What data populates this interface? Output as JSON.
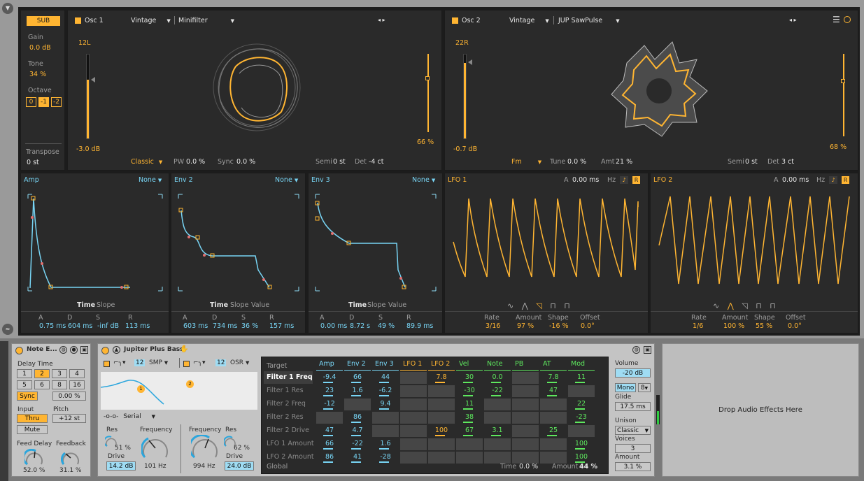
{
  "sub": {
    "label": "SUB",
    "gain_label": "Gain",
    "gain": "0.0 dB",
    "tone_label": "Tone",
    "tone": "34 %",
    "octave_label": "Octave",
    "octaves": [
      "0",
      "-1",
      "-2"
    ],
    "transpose_label": "Transpose",
    "transpose": "0 st"
  },
  "osc1": {
    "title": "Osc 1",
    "type": "Vintage",
    "filter": "Minifilter",
    "level": "12L",
    "db": "-3.0 dB",
    "right_pct": "66 %",
    "mode": "Classic",
    "pw_label": "PW",
    "pw": "0.0 %",
    "sync_label": "Sync",
    "sync": "0.0 %",
    "semi_label": "Semi",
    "semi": "0 st",
    "det_label": "Det",
    "det": "-4 ct"
  },
  "osc2": {
    "title": "Osc 2",
    "type": "Vintage",
    "wave": "JUP SawPulse",
    "level": "22R",
    "db": "-0.7 dB",
    "right_pct": "68 %",
    "mode": "Fm",
    "tune_label": "Tune",
    "tune": "0.0 %",
    "amt_label": "Amt",
    "amt": "21 %",
    "semi_label": "Semi",
    "semi": "0 st",
    "det_label": "Det",
    "det": "3 ct"
  },
  "env": [
    {
      "title": "Amp",
      "mode": "None",
      "tabs": [
        "Time",
        "Slope"
      ],
      "a": "0.75 ms",
      "d": "604 ms",
      "s": "-inf dB",
      "r": "113 ms"
    },
    {
      "title": "Env 2",
      "mode": "None",
      "tabs": [
        "Time",
        "Slope",
        "Value"
      ],
      "a": "603 ms",
      "d": "734 ms",
      "s": "36 %",
      "r": "157 ms"
    },
    {
      "title": "Env 3",
      "mode": "None",
      "tabs": [
        "Time",
        "Slope",
        "Value"
      ],
      "a": "0.00 ms",
      "d": "8.72 s",
      "s": "49 %",
      "r": "89.9 ms"
    }
  ],
  "env_labels": {
    "a": "A",
    "d": "D",
    "s": "S",
    "r": "R"
  },
  "lfo": [
    {
      "title": "LFO 1",
      "a": "A",
      "a_val": "0.00 ms",
      "hz": "Hz",
      "r": "R",
      "rate": "3/16",
      "amount": "97 %",
      "shape": "-16 %",
      "offset": "0.0°"
    },
    {
      "title": "LFO 2",
      "a": "A",
      "a_val": "0.00 ms",
      "hz": "Hz",
      "r": "R",
      "rate": "1/6",
      "amount": "100 %",
      "shape": "55 %",
      "offset": "0.0°"
    }
  ],
  "lfo_labels": {
    "rate": "Rate",
    "amount": "Amount",
    "shape": "Shape",
    "offset": "Offset"
  },
  "note_echo": {
    "title": "Note E...",
    "delay_time": "Delay Time",
    "buttons": [
      "1",
      "2",
      "3",
      "4",
      "5",
      "6",
      "8",
      "16"
    ],
    "sync": "Sync",
    "sync_val": "0.00 %",
    "input": "Input",
    "pitch": "Pitch",
    "thru": "Thru",
    "pitch_val": "+12 st",
    "mute": "Mute",
    "feed_delay": "Feed Delay",
    "feedback": "Feedback",
    "feed_delay_val": "52.0 %",
    "feedback_val": "31.1 %"
  },
  "jupiter": {
    "title": "Jupiter Plus Bass",
    "f1num": "12",
    "f1type": "SMP",
    "f2num": "12",
    "f2type": "OSR",
    "routing": "Serial",
    "res_label": "Res",
    "res1": "51 %",
    "freq_label": "Frequency",
    "drive_label": "Drive",
    "drive1": "14.2 dB",
    "freq1": "101 Hz",
    "freq2": "994 Hz",
    "res2": "62 %",
    "drive2": "24.0 dB",
    "badge1": "1",
    "badge2": "2"
  },
  "matrix": {
    "target_label": "Target",
    "columns": [
      "Amp",
      "Env 2",
      "Env 3",
      "LFO 1",
      "LFO 2",
      "Vel",
      "Note",
      "PB",
      "AT",
      "Mod"
    ],
    "rows": [
      {
        "name": "Filter 1 Freq",
        "vals": [
          "-9.4",
          "66",
          "44",
          "",
          "7.8",
          "30",
          "0.0",
          "",
          "7.8",
          "11"
        ]
      },
      {
        "name": "Filter 1 Res",
        "vals": [
          "23",
          "1.6",
          "-6.2",
          "",
          "",
          "-30",
          "-22",
          "",
          "47",
          ""
        ]
      },
      {
        "name": "Filter 2 Freq",
        "vals": [
          "-12",
          "",
          "9.4",
          "",
          "",
          "11",
          "",
          "",
          "",
          "22"
        ]
      },
      {
        "name": "Filter 2 Res",
        "vals": [
          "",
          "86",
          "",
          "",
          "",
          "38",
          "",
          "",
          "",
          "-23"
        ]
      },
      {
        "name": "Filter 2 Drive",
        "vals": [
          "47",
          "4.7",
          "",
          "",
          "100",
          "67",
          "3.1",
          "",
          "25",
          ""
        ]
      },
      {
        "name": "LFO 1 Amount",
        "vals": [
          "66",
          "-22",
          "1.6",
          "",
          "",
          "",
          "",
          "",
          "",
          "100"
        ]
      },
      {
        "name": "LFO 2 Amount",
        "vals": [
          "86",
          "41",
          "-28",
          "",
          "",
          "",
          "",
          "",
          "",
          "100"
        ]
      }
    ],
    "global": "Global",
    "time_label": "Time",
    "time": "0.0 %",
    "amount_label": "Amount",
    "amount": "44 %"
  },
  "voice": {
    "volume_label": "Volume",
    "volume": "-20 dB",
    "mono": "Mono",
    "voices_n": "8",
    "glide_label": "Glide",
    "glide": "17.5 ms",
    "unison_label": "Unison",
    "unison": "Classic",
    "voices_label": "Voices",
    "voices": "3",
    "amount_label": "Amount",
    "amount": "3.1 %"
  },
  "drop": "Drop Audio Effects Here"
}
